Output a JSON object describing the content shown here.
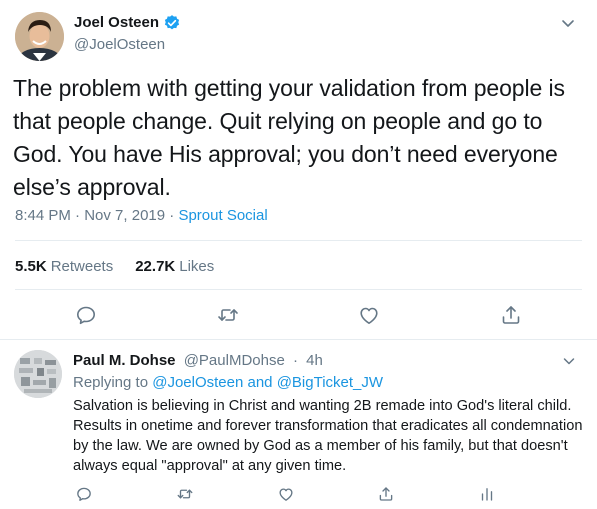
{
  "tweet": {
    "author_name": "Joel Osteen",
    "handle": "@JoelOsteen",
    "text": "The problem with getting your validation from people is that people change. Quit relying on people and go to God. You have His approval; you don’t need everyone else’s approval.",
    "time": "8:44 PM",
    "date": "Nov 7, 2019",
    "separator": "·",
    "source": "Sprout Social",
    "retweets_count": "5.5K",
    "retweets_label": "Retweets",
    "likes_count": "22.7K",
    "likes_label": "Likes"
  },
  "reply": {
    "author_name": "Paul M. Dohse",
    "handle": "@PaulMDohse",
    "separator": "·",
    "time_ago": "4h",
    "replying_prefix": "Replying to",
    "mention_1": "@JoelOsteen",
    "and_word": "and",
    "mention_2": "@BigTicket_JW",
    "text": "Salvation is believing in Christ and wanting 2B remade into God's literal child. Results in onetime and forever transformation that eradicates all condemnation by the law. We are owned by God as a member of his family, but that doesn't always equal \"approval\" at any given time."
  },
  "colors": {
    "text": "#14171a",
    "secondary": "#657786",
    "link": "#1b95e0",
    "verified": "#1da1f2",
    "divider": "#e6ecf0"
  },
  "icons": [
    "verified-badge-icon",
    "chevron-down-icon",
    "reply-icon",
    "retweet-icon",
    "like-icon",
    "share-icon",
    "analytics-icon"
  ]
}
